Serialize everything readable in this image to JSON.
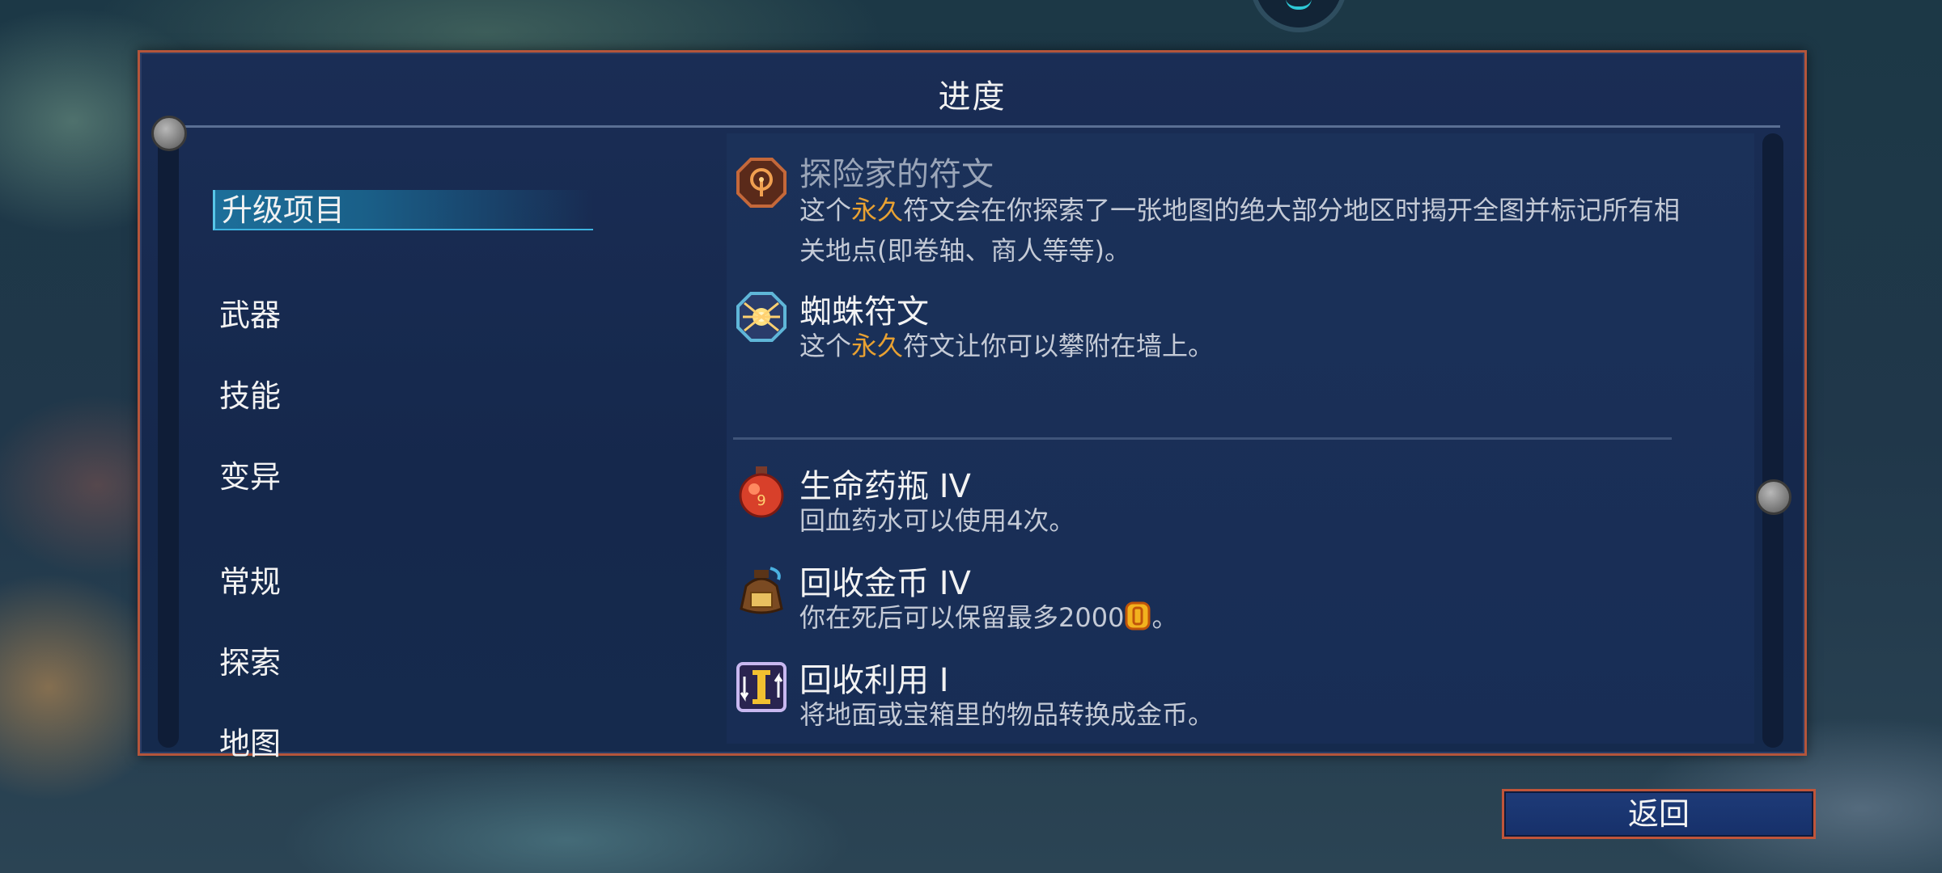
{
  "panel": {
    "title": "进度"
  },
  "categories": [
    {
      "label": "升级项目",
      "selected": true
    },
    {
      "label": "武器"
    },
    {
      "label": "技能"
    },
    {
      "label": "变异"
    },
    {
      "label": "常规"
    },
    {
      "label": "探索"
    },
    {
      "label": "地图"
    }
  ],
  "items": [
    {
      "name": "探险家的符文",
      "icon": "explorer-rune-icon",
      "desc_before": "这个",
      "desc_highlight": "永久",
      "desc_after": "符文会在你探索了一张地图的绝大部分地区时揭开全图并标记所有相关地点(即卷轴、商人等等)。"
    },
    {
      "name": "蜘蛛符文",
      "icon": "spider-rune-icon",
      "desc_before": "这个",
      "desc_highlight": "永久",
      "desc_after": "符文让你可以攀附在墙上。"
    },
    {
      "name": "生命药瓶 IV",
      "icon": "health-flask-icon",
      "flask_charges": "9",
      "desc": "回血药水可以使用4次。"
    },
    {
      "name": "回收金币 IV",
      "icon": "gold-bag-icon",
      "desc_before": "你在死后可以保留最多2000",
      "desc_after": "。",
      "coin_icon": "gold-coin-icon"
    },
    {
      "name": "回收利用 I",
      "icon": "recycle-icon",
      "desc": "将地面或宝箱里的物品转换成金币。"
    }
  ],
  "back_button": {
    "label": "返回"
  },
  "colors": {
    "highlight": "#e8a132",
    "frame": "#b4553b",
    "panel": "#1a2d55"
  }
}
